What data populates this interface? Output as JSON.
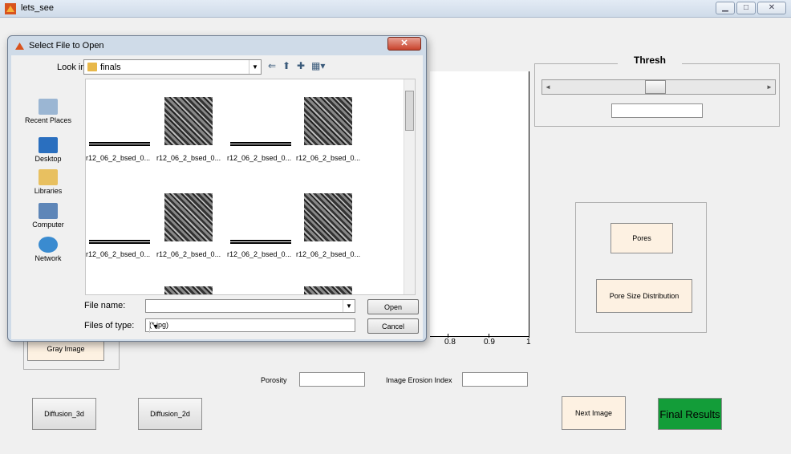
{
  "window": {
    "title": "lets_see"
  },
  "thresh": {
    "label": "Thresh",
    "value": ""
  },
  "axis": {
    "tick_labels": [
      "0.8",
      "0.9",
      "1"
    ]
  },
  "buttons": {
    "gray_image": "Gray Image",
    "pores": "Pores",
    "pore_size_distribution": "Pore Size Distribution",
    "diffusion_3d": "Diffusion_3d",
    "diffusion_2d": "Diffusion_2d",
    "next_image": "Next Image",
    "final_results": "Final Results"
  },
  "fields": {
    "porosity_label": "Porosity",
    "porosity_value": "",
    "erosion_label": "Image Erosion Index",
    "erosion_value": ""
  },
  "dialog": {
    "title": "Select File to Open",
    "look_in_label": "Look in:",
    "folder": "finals",
    "places": [
      "Recent Places",
      "Desktop",
      "Libraries",
      "Computer",
      "Network"
    ],
    "files": [
      "r12_06_2_bsed_0...",
      "r12_06_2_bsed_0...",
      "r12_06_2_bsed_0...",
      "r12_06_2_bsed_0...",
      "r12_06_2_bsed_0...",
      "r12_06_2_bsed_0...",
      "r12_06_2_bsed_0...",
      "r12_06_2_bsed_0..."
    ],
    "file_name_label": "File name:",
    "file_name_value": "",
    "file_type_label": "Files of type:",
    "file_type_value": "(*.jpg)",
    "open_label": "Open",
    "cancel_label": "Cancel"
  },
  "colors": {
    "final_results_bg": "#139d39",
    "cream_button": "#fdf1e2"
  }
}
